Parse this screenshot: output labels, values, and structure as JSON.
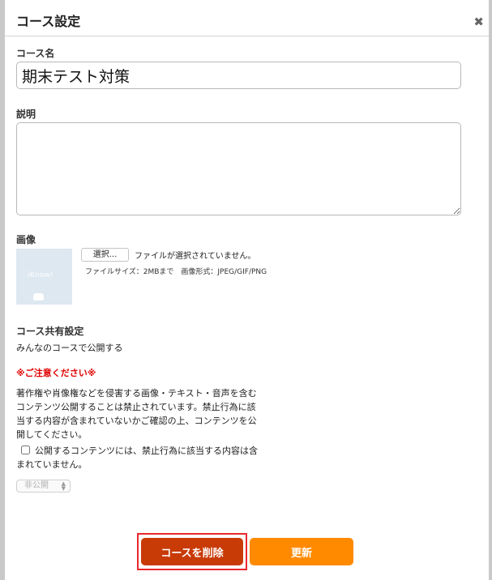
{
  "dialog": {
    "title": "コース設定",
    "close_icon": "close-icon",
    "close_glyph": "✖"
  },
  "course_name": {
    "label": "コース名",
    "value": "期末テスト対策"
  },
  "description": {
    "label": "説明",
    "value": ""
  },
  "image": {
    "label": "画像",
    "thumbnail_text": "iKnow!",
    "select_button_label": "選択...",
    "file_status": "ファイルが選択されていません。",
    "file_spec": "ファイルサイズ：2MBまで　画像形式：JPEG/GIF/PNG"
  },
  "sharing": {
    "label": "コース共有設定",
    "subtext": "みんなのコースで公開する",
    "caution": "※ご注意ください※",
    "notice": "著作権や肖像権などを侵害する画像・テキスト・音声を含むコンテンツ公開することは禁止されています。禁止行為に該当する内容が含まれていないかご確認の上、コンテンツを公開してください。",
    "agree_label": "公開するコンテンツには、禁止行為に該当する内容は含まれていません。",
    "agree_checked": false,
    "visibility_selected": "非公開",
    "visibility_arrow": "⌃⌄"
  },
  "actions": {
    "delete_label": "コースを削除",
    "update_label": "更新"
  },
  "colors": {
    "delete_button": "#c83a06",
    "update_button": "#ff8a00",
    "caution_text": "#e00000",
    "highlight_outline": "#e8282e"
  }
}
